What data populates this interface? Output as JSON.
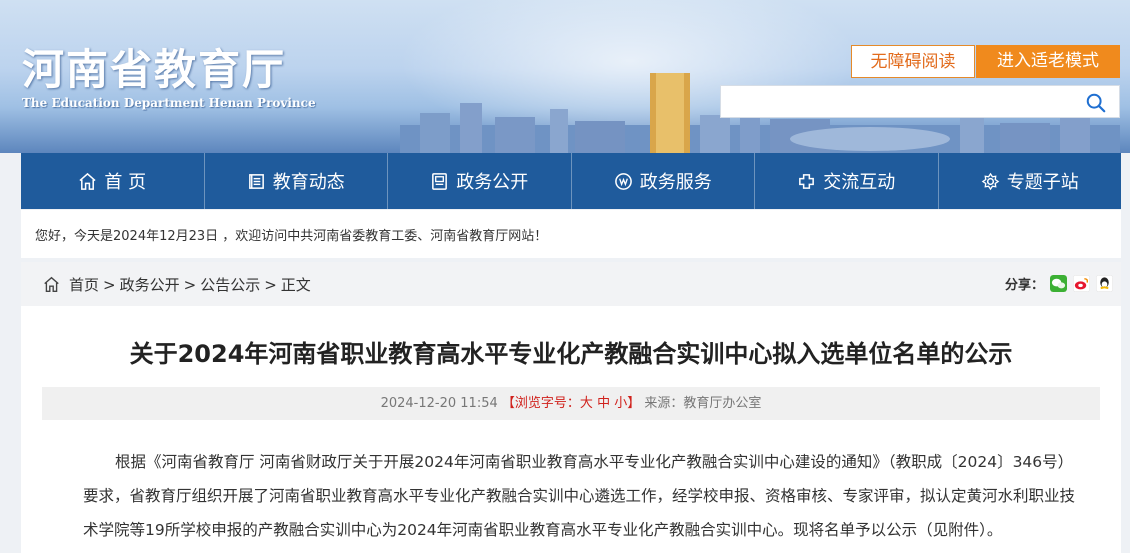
{
  "header": {
    "logo_cn": "河南省教育厅",
    "logo_en": "The Education Department Henan Province",
    "accessibility_label": "无障碍阅读",
    "elder_mode_label": "进入适老模式",
    "search_placeholder": "",
    "colors": {
      "accent_orange": "#f08a1d",
      "nav_blue": "#1f5b9c"
    }
  },
  "nav": {
    "items": [
      {
        "label": "首 页",
        "icon": "home-icon"
      },
      {
        "label": "教育动态",
        "icon": "news-icon"
      },
      {
        "label": "政务公开",
        "icon": "document-icon"
      },
      {
        "label": "政务服务",
        "icon": "service-icon"
      },
      {
        "label": "交流互动",
        "icon": "interaction-icon"
      },
      {
        "label": "专题子站",
        "icon": "gear-icon"
      }
    ]
  },
  "welcome": {
    "text": "您好，今天是2024年12月23日 ，欢迎访问中共河南省委教育工委、河南省教育厅网站！"
  },
  "breadcrumb": {
    "items": [
      "首页",
      "政务公开",
      "公告公示",
      "正文"
    ],
    "share_label": "分享："
  },
  "article": {
    "title": "关于2024年河南省职业教育高水平专业化产教融合实训中心拟入选单位名单的公示",
    "date": "2024-12-20 11:54",
    "font_size_prefix": "【浏览字号：",
    "font_large": "大",
    "font_medium": "中",
    "font_small": "小",
    "font_size_suffix": "】",
    "source": "来源：教育厅办公室",
    "body": "根据《河南省教育厅 河南省财政厅关于开展2024年河南省职业教育高水平专业化产教融合实训中心建设的通知》（教职成〔2024〕346号）要求，省教育厅组织开展了河南省职业教育高水平专业化产教融合实训中心遴选工作，经学校申报、资格审核、专家评审，拟认定黄河水利职业技术学院等19所学校申报的产教融合实训中心为2024年河南省职业教育高水平专业化产教融合实训中心。现将名单予以公示（见附件）。"
  }
}
